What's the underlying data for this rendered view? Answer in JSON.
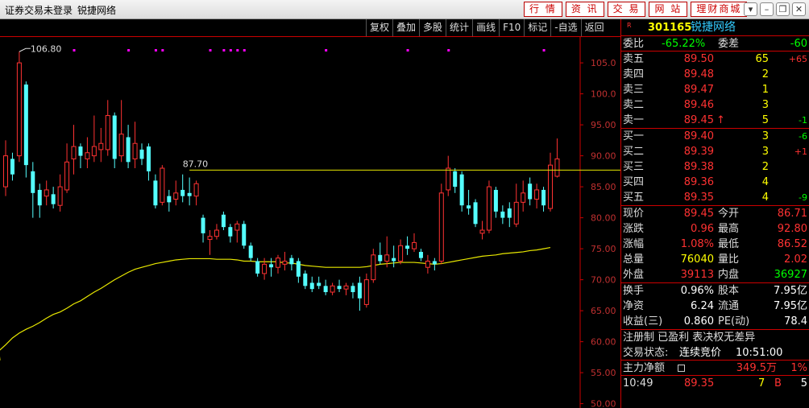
{
  "window": {
    "title": "证券交易未登录",
    "subtitle": "锐捷网络",
    "menu": [
      "行 情",
      "资 讯",
      "交 易",
      "网 站",
      "理财商城"
    ],
    "controls": [
      "▾",
      "–",
      "❐",
      "✕"
    ]
  },
  "toolbar": [
    "复权",
    "叠加",
    "多股",
    "统计",
    "画线",
    "F10",
    "标记",
    "-自选",
    "返回"
  ],
  "chart_data": {
    "type": "candlestick",
    "yaxis_ticks": [
      "105.0",
      "100.0",
      "95.00",
      "90.00",
      "85.00",
      "80.00",
      "75.00",
      "70.00",
      "65.00",
      "60.00",
      "55.00",
      "50.00"
    ],
    "ylim": [
      49.3,
      109.3
    ],
    "high_label": "106.80",
    "ref_line_label": "87.70",
    "ref_line_value": 87.7,
    "candles": [
      {
        "o": 85.0,
        "c": 90.0,
        "h": 92.5,
        "l": 83.5
      },
      {
        "o": 89.5,
        "c": 87.0,
        "h": 90.5,
        "l": 86.0
      },
      {
        "o": 90.0,
        "c": 105.0,
        "h": 106.8,
        "l": 89.0
      },
      {
        "o": 101.5,
        "c": 88.5,
        "h": 102.0,
        "l": 86.5
      },
      {
        "o": 87.5,
        "c": 84.0,
        "h": 89.0,
        "l": 80.0
      },
      {
        "o": 84.5,
        "c": 82.0,
        "h": 85.5,
        "l": 80.0
      },
      {
        "o": 83.5,
        "c": 84.5,
        "h": 86.0,
        "l": 82.0
      },
      {
        "o": 83.8,
        "c": 82.2,
        "h": 85.0,
        "l": 81.5
      },
      {
        "o": 82.0,
        "c": 85.0,
        "h": 87.0,
        "l": 81.0
      },
      {
        "o": 84.5,
        "c": 89.0,
        "h": 92.0,
        "l": 84.0
      },
      {
        "o": 89.5,
        "c": 91.5,
        "h": 95.0,
        "l": 87.0
      },
      {
        "o": 91.5,
        "c": 90.0,
        "h": 92.0,
        "l": 88.0
      },
      {
        "o": 89.5,
        "c": 90.5,
        "h": 93.0,
        "l": 88.0
      },
      {
        "o": 90.0,
        "c": 91.5,
        "h": 96.5,
        "l": 89.0
      },
      {
        "o": 91.0,
        "c": 92.0,
        "h": 94.5,
        "l": 89.0
      },
      {
        "o": 91.0,
        "c": 96.5,
        "h": 99.0,
        "l": 90.0
      },
      {
        "o": 96.5,
        "c": 89.5,
        "h": 97.0,
        "l": 88.0
      },
      {
        "o": 90.0,
        "c": 93.5,
        "h": 99.0,
        "l": 89.0
      },
      {
        "o": 93.0,
        "c": 89.0,
        "h": 95.0,
        "l": 88.0
      },
      {
        "o": 89.5,
        "c": 92.0,
        "h": 95.5,
        "l": 88.0
      },
      {
        "o": 91.0,
        "c": 89.5,
        "h": 92.0,
        "l": 88.5
      },
      {
        "o": 91.5,
        "c": 87.5,
        "h": 92.0,
        "l": 86.0
      },
      {
        "o": 86.0,
        "c": 82.0,
        "h": 87.0,
        "l": 81.5
      },
      {
        "o": 82.5,
        "c": 88.0,
        "h": 88.5,
        "l": 82.0
      },
      {
        "o": 83.5,
        "c": 82.5,
        "h": 84.5,
        "l": 81.0
      },
      {
        "o": 83.0,
        "c": 84.0,
        "h": 86.0,
        "l": 82.0
      },
      {
        "o": 84.5,
        "c": 83.5,
        "h": 87.0,
        "l": 82.5
      },
      {
        "o": 84.0,
        "c": 83.5,
        "h": 86.5,
        "l": 82.0
      },
      {
        "o": 83.5,
        "c": 85.5,
        "h": 86.0,
        "l": 82.0
      },
      {
        "o": 80.0,
        "c": 77.5,
        "h": 80.5,
        "l": 76.0
      },
      {
        "o": 76.5,
        "c": 77.0,
        "h": 78.0,
        "l": 74.0
      },
      {
        "o": 77.0,
        "c": 78.0,
        "h": 79.0,
        "l": 76.5
      },
      {
        "o": 80.5,
        "c": 78.5,
        "h": 81.0,
        "l": 78.0
      },
      {
        "o": 78.5,
        "c": 77.0,
        "h": 79.0,
        "l": 76.0
      },
      {
        "o": 78.0,
        "c": 79.0,
        "h": 79.5,
        "l": 76.0
      },
      {
        "o": 79.0,
        "c": 75.5,
        "h": 79.5,
        "l": 75.0
      },
      {
        "o": 75.5,
        "c": 73.5,
        "h": 76.0,
        "l": 73.0
      },
      {
        "o": 73.0,
        "c": 71.0,
        "h": 73.5,
        "l": 70.5
      },
      {
        "o": 71.0,
        "c": 72.5,
        "h": 73.5,
        "l": 70.0
      },
      {
        "o": 72.5,
        "c": 72.0,
        "h": 73.5,
        "l": 70.5
      },
      {
        "o": 72.0,
        "c": 73.5,
        "h": 74.0,
        "l": 71.0
      },
      {
        "o": 72.5,
        "c": 73.0,
        "h": 74.5,
        "l": 71.5
      },
      {
        "o": 73.5,
        "c": 72.5,
        "h": 74.0,
        "l": 71.5
      },
      {
        "o": 73.0,
        "c": 70.5,
        "h": 73.5,
        "l": 69.5
      },
      {
        "o": 71.0,
        "c": 69.0,
        "h": 71.5,
        "l": 68.5
      },
      {
        "o": 69.5,
        "c": 68.5,
        "h": 70.5,
        "l": 68.0
      },
      {
        "o": 69.5,
        "c": 69.0,
        "h": 70.5,
        "l": 68.5
      },
      {
        "o": 69.0,
        "c": 68.0,
        "h": 70.0,
        "l": 67.5
      },
      {
        "o": 68.0,
        "c": 69.0,
        "h": 69.5,
        "l": 67.5
      },
      {
        "o": 69.0,
        "c": 68.5,
        "h": 70.0,
        "l": 68.0
      },
      {
        "o": 68.5,
        "c": 69.0,
        "h": 69.5,
        "l": 67.5
      },
      {
        "o": 69.0,
        "c": 68.0,
        "h": 69.5,
        "l": 67.0
      },
      {
        "o": 69.5,
        "c": 67.0,
        "h": 70.5,
        "l": 65.0
      },
      {
        "o": 66.0,
        "c": 70.0,
        "h": 71.0,
        "l": 65.5
      },
      {
        "o": 70.0,
        "c": 74.0,
        "h": 75.0,
        "l": 69.5
      },
      {
        "o": 74.0,
        "c": 73.0,
        "h": 76.0,
        "l": 72.5
      },
      {
        "o": 73.0,
        "c": 74.0,
        "h": 77.0,
        "l": 72.0
      },
      {
        "o": 73.5,
        "c": 73.0,
        "h": 75.5,
        "l": 72.0
      },
      {
        "o": 73.0,
        "c": 75.5,
        "h": 76.5,
        "l": 72.5
      },
      {
        "o": 75.5,
        "c": 75.0,
        "h": 77.0,
        "l": 74.0
      },
      {
        "o": 75.0,
        "c": 76.0,
        "h": 77.5,
        "l": 74.5
      },
      {
        "o": 74.5,
        "c": 73.5,
        "h": 75.0,
        "l": 73.0
      },
      {
        "o": 72.0,
        "c": 73.0,
        "h": 74.0,
        "l": 71.0
      },
      {
        "o": 73.0,
        "c": 72.5,
        "h": 73.5,
        "l": 71.5
      },
      {
        "o": 73.0,
        "c": 84.0,
        "h": 85.5,
        "l": 72.5
      },
      {
        "o": 84.5,
        "c": 88.0,
        "h": 90.0,
        "l": 83.5
      },
      {
        "o": 87.5,
        "c": 85.0,
        "h": 88.0,
        "l": 84.0
      },
      {
        "o": 87.0,
        "c": 82.0,
        "h": 87.5,
        "l": 81.0
      },
      {
        "o": 82.0,
        "c": 81.5,
        "h": 84.5,
        "l": 80.5
      },
      {
        "o": 82.5,
        "c": 79.0,
        "h": 83.0,
        "l": 78.5
      },
      {
        "o": 77.5,
        "c": 78.0,
        "h": 79.5,
        "l": 76.5
      },
      {
        "o": 78.0,
        "c": 85.0,
        "h": 86.0,
        "l": 77.5
      },
      {
        "o": 84.5,
        "c": 81.0,
        "h": 85.0,
        "l": 80.0
      },
      {
        "o": 81.0,
        "c": 80.0,
        "h": 82.0,
        "l": 79.0
      },
      {
        "o": 81.5,
        "c": 80.0,
        "h": 82.5,
        "l": 78.5
      },
      {
        "o": 79.0,
        "c": 82.5,
        "h": 85.5,
        "l": 78.5
      },
      {
        "o": 82.5,
        "c": 84.0,
        "h": 86.0,
        "l": 81.0
      },
      {
        "o": 85.5,
        "c": 83.0,
        "h": 86.5,
        "l": 82.0
      },
      {
        "o": 83.0,
        "c": 84.5,
        "h": 85.5,
        "l": 81.5
      },
      {
        "o": 84.5,
        "c": 82.0,
        "h": 85.0,
        "l": 81.0
      },
      {
        "o": 81.5,
        "c": 88.5,
        "h": 90.5,
        "l": 81.0
      },
      {
        "o": 86.7,
        "c": 89.5,
        "h": 92.8,
        "l": 86.5
      }
    ],
    "ma": [
      58.5,
      59.5,
      60.6,
      61.4,
      62.0,
      62.5,
      63.1,
      63.8,
      64.4,
      64.8,
      65.4,
      66.1,
      66.6,
      67.3,
      68.0,
      68.6,
      69.3,
      70.0,
      70.6,
      71.2,
      71.7,
      72.0,
      72.3,
      72.6,
      72.8,
      73.0,
      73.2,
      73.3,
      73.4,
      73.4,
      73.4,
      73.4,
      73.3,
      73.3,
      73.3,
      73.2,
      73.0,
      73.0,
      72.9,
      72.9,
      72.9,
      72.9,
      72.7,
      72.7,
      72.5,
      72.3,
      72.2,
      72.1,
      72.0,
      72.0,
      72.0,
      72.0,
      72.0,
      72.0,
      72.1,
      72.3,
      72.5,
      72.6,
      72.7,
      72.8,
      72.8,
      72.8,
      72.7,
      72.6,
      72.5,
      72.6,
      72.8,
      73.0,
      73.2,
      73.4,
      73.6,
      73.8,
      73.9,
      74.0,
      74.2,
      74.3,
      74.4,
      74.5,
      74.7,
      74.8,
      75.0,
      75.2
    ]
  },
  "quote": {
    "code": "301165",
    "name": "锐捷网络",
    "r_mark": "R",
    "weibi_label": "委比",
    "weibi": "-65.22%",
    "weicha_label": "委差",
    "weicha": "-60",
    "asks": [
      {
        "label": "卖五",
        "price": "89.50",
        "vol": "65",
        "chg": "+65",
        "arrow": ""
      },
      {
        "label": "卖四",
        "price": "89.48",
        "vol": "2",
        "chg": "",
        "arrow": ""
      },
      {
        "label": "卖三",
        "price": "89.47",
        "vol": "1",
        "chg": "",
        "arrow": ""
      },
      {
        "label": "卖二",
        "price": "89.46",
        "vol": "3",
        "chg": "",
        "arrow": ""
      },
      {
        "label": "卖一",
        "price": "89.45",
        "vol": "5",
        "chg": "-1",
        "arrow": "↑"
      }
    ],
    "bids": [
      {
        "label": "买一",
        "price": "89.40",
        "vol": "3",
        "chg": "-6"
      },
      {
        "label": "买二",
        "price": "89.39",
        "vol": "3",
        "chg": "+1"
      },
      {
        "label": "买三",
        "price": "89.38",
        "vol": "2",
        "chg": ""
      },
      {
        "label": "买四",
        "price": "89.36",
        "vol": "4",
        "chg": ""
      },
      {
        "label": "买五",
        "price": "89.35",
        "vol": "4",
        "chg": "-9"
      }
    ],
    "stats": [
      {
        "l1": "现价",
        "v1": "89.45",
        "c1": "red",
        "l2": "今开",
        "v2": "86.71",
        "c2": "red"
      },
      {
        "l1": "涨跌",
        "v1": "0.96",
        "c1": "red",
        "l2": "最高",
        "v2": "92.80",
        "c2": "red"
      },
      {
        "l1": "涨幅",
        "v1": "1.08%",
        "c1": "red",
        "l2": "最低",
        "v2": "86.52",
        "c2": "red"
      },
      {
        "l1": "总量",
        "v1": "76040",
        "c1": "yel",
        "l2": "量比",
        "v2": "2.02",
        "c2": "red"
      },
      {
        "l1": "外盘",
        "v1": "39113",
        "c1": "red",
        "l2": "内盘",
        "v2": "36927",
        "c2": "grn"
      }
    ],
    "fin": [
      {
        "l1": "换手",
        "v1": "0.96%",
        "l2": "股本",
        "v2": "7.95亿"
      },
      {
        "l1": "净资",
        "v1": "6.24",
        "l2": "流通",
        "v2": "7.95亿"
      },
      {
        "l1": "收益(三)",
        "v1": "0.860",
        "l2": "PE(动)",
        "v2": "78.4"
      }
    ],
    "tags": "注册制 已盈利 表决权无差异",
    "status_label": "交易状态:",
    "status": "连续竞价",
    "status_time": "10:51:00",
    "main_flow_label": "主力净额",
    "main_flow": "349.5万",
    "main_flow_pct": "1%",
    "tick": {
      "time": "10:49",
      "price": "89.35",
      "vol": "7",
      "side": "B",
      "count": "5"
    }
  },
  "colors": {
    "up": "#ff3232",
    "down": "#54ffff",
    "ma": "#e8e800",
    "ref": "#e8e800",
    "marker": "#ff00ff"
  }
}
